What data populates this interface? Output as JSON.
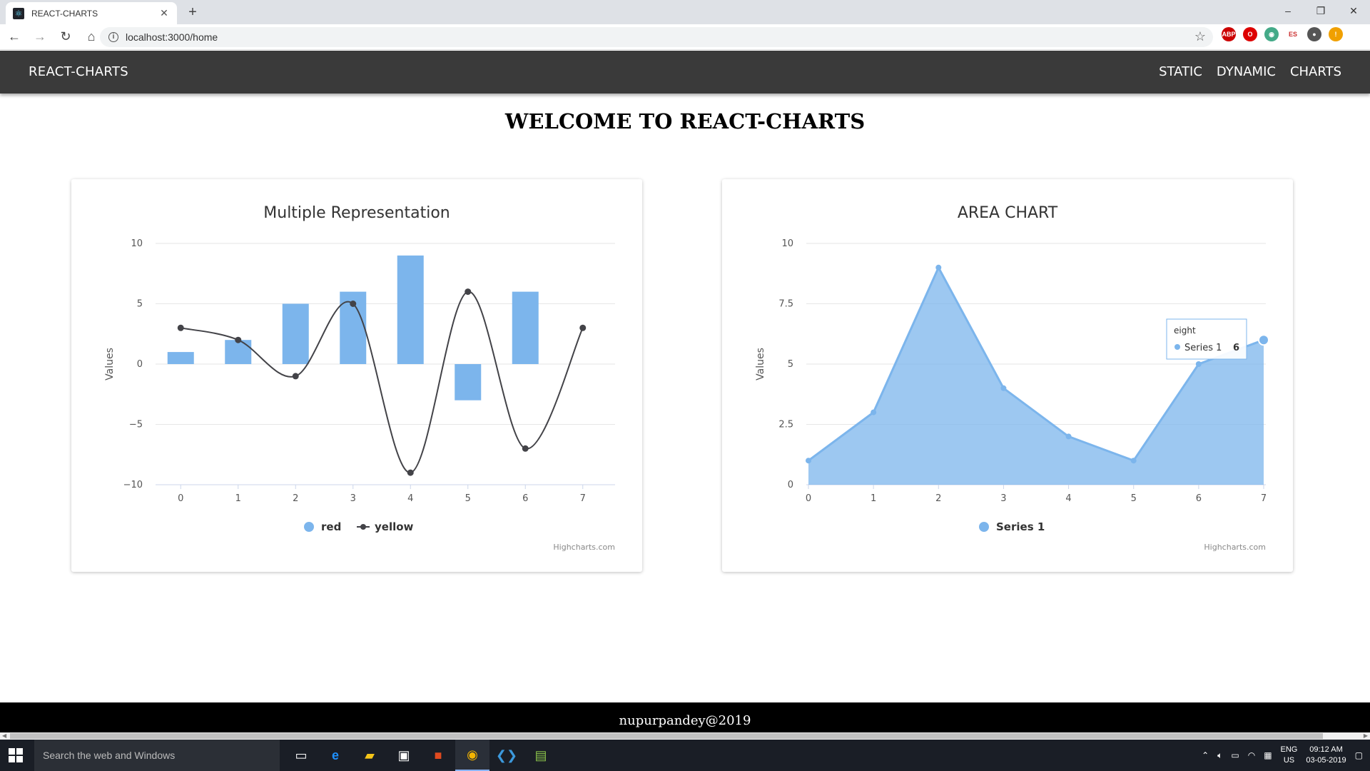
{
  "browser": {
    "tab_title": "REACT-CHARTS",
    "new_tab_icon": "+",
    "url": "localhost:3000/home",
    "window_controls": [
      "–",
      "❐",
      "✕"
    ]
  },
  "navbar": {
    "brand": "REACT-CHARTS",
    "links": [
      "STATIC",
      "DYNAMIC",
      "CHARTS"
    ],
    "bg_color": "#3a3a3a"
  },
  "page": {
    "heading": "WELCOME TO REACT-CHARTS",
    "footer": "nupurpandey@2019"
  },
  "chart_data": [
    {
      "type": "bar+spline",
      "title": "Multiple Representation",
      "ylabel": "Values",
      "ylim": [
        -10,
        10
      ],
      "yticks": [
        10,
        5,
        0,
        -5,
        -10
      ],
      "ytick_labels": [
        "10",
        "5",
        "0",
        "−5",
        "−10"
      ],
      "categories": [
        "0",
        "1",
        "2",
        "3",
        "4",
        "5",
        "6",
        "7"
      ],
      "series": [
        {
          "name": "red",
          "type": "column",
          "color": "#7cb5ec",
          "values": [
            1,
            2,
            5,
            6,
            9,
            -3,
            6,
            null
          ]
        },
        {
          "name": "yellow",
          "type": "spline",
          "color": "#434348",
          "values": [
            3,
            2,
            -1,
            5,
            -9,
            6,
            -7,
            3
          ]
        }
      ],
      "credits": "Highcharts.com",
      "legend": "bottom-center"
    },
    {
      "type": "area",
      "title": "AREA CHART",
      "ylabel": "Values",
      "ylim": [
        0,
        10
      ],
      "yticks": [
        10,
        7.5,
        5,
        2.5,
        0
      ],
      "ytick_labels": [
        "10",
        "7.5",
        "5",
        "2.5",
        "0"
      ],
      "categories": [
        "0",
        "1",
        "2",
        "3",
        "4",
        "5",
        "6",
        "7"
      ],
      "series": [
        {
          "name": "Series 1",
          "color": "#7cb5ec",
          "values": [
            1,
            3,
            9,
            4,
            2,
            1,
            5,
            6
          ]
        }
      ],
      "tooltip": {
        "header": "eight",
        "series": "Series 1",
        "value": "6"
      },
      "credits": "Highcharts.com",
      "legend": "bottom-center"
    }
  ],
  "taskbar": {
    "search_placeholder": "Search the web and Windows",
    "lang_top": "ENG",
    "lang_bottom": "US",
    "time": "09:12 AM",
    "date": "03-05-2019"
  }
}
